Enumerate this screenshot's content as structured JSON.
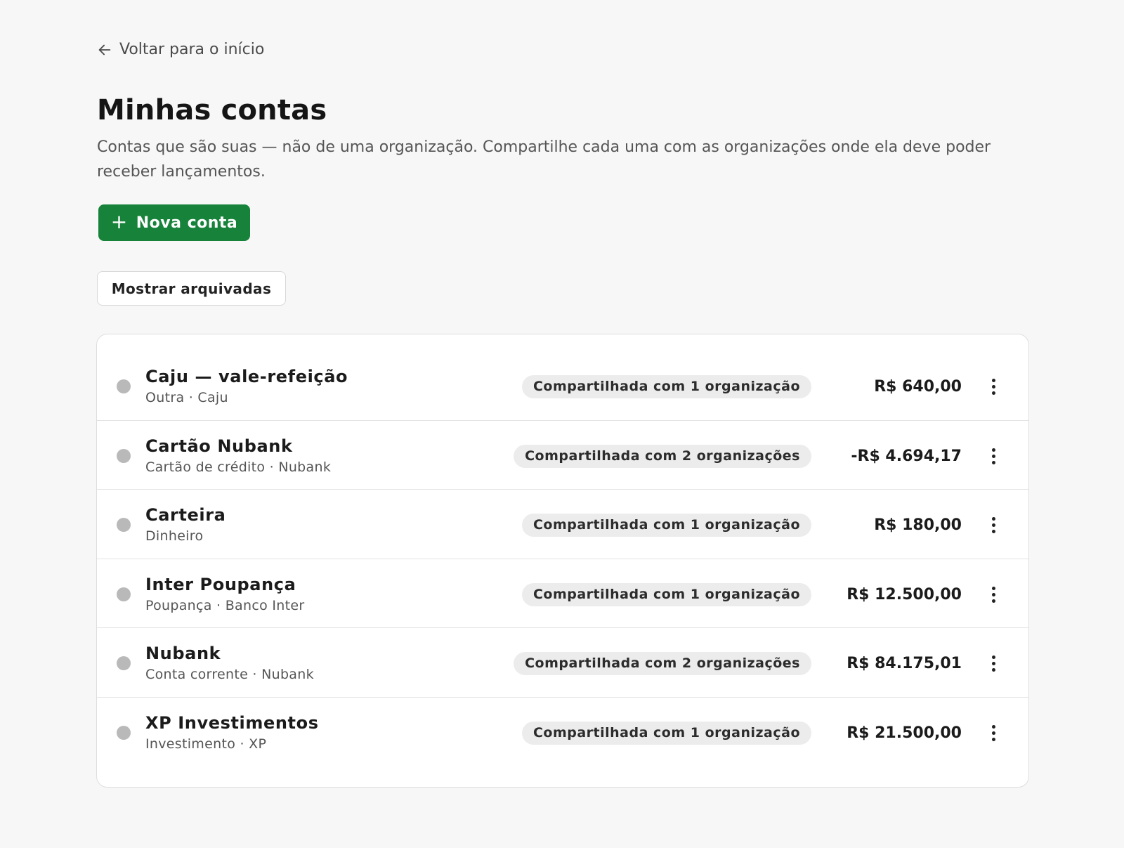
{
  "nav": {
    "back_label": "Voltar para o início",
    "back_icon": "arrow-left-icon"
  },
  "header": {
    "title": "Minhas contas",
    "description": "Contas que são suas — não de uma organização. Compartilhe cada uma com as organizações onde ela deve poder receber lançamentos."
  },
  "actions": {
    "new_account_label": "Nova conta",
    "new_account_icon": "plus-icon",
    "show_archived_label": "Mostrar arquivadas"
  },
  "colors": {
    "primary": "#17823a",
    "status_dot": "#b9b9b9",
    "badge_bg": "#ececec"
  },
  "accounts": [
    {
      "name": "Caju — vale-refeição",
      "subtitle": "Outra · Caju",
      "shared": "Compartilhada com 1 organização",
      "balance": "R$ 640,00"
    },
    {
      "name": "Cartão Nubank",
      "subtitle": "Cartão de crédito · Nubank",
      "shared": "Compartilhada com 2 organizações",
      "balance": "-R$ 4.694,17"
    },
    {
      "name": "Carteira",
      "subtitle": "Dinheiro",
      "shared": "Compartilhada com 1 organização",
      "balance": "R$ 180,00"
    },
    {
      "name": "Inter Poupança",
      "subtitle": "Poupança · Banco Inter",
      "shared": "Compartilhada com 1 organização",
      "balance": "R$ 12.500,00"
    },
    {
      "name": "Nubank",
      "subtitle": "Conta corrente · Nubank",
      "shared": "Compartilhada com 2 organizações",
      "balance": "R$ 84.175,01"
    },
    {
      "name": "XP Investimentos",
      "subtitle": "Investimento · XP",
      "shared": "Compartilhada com 1 organização",
      "balance": "R$ 21.500,00"
    }
  ]
}
